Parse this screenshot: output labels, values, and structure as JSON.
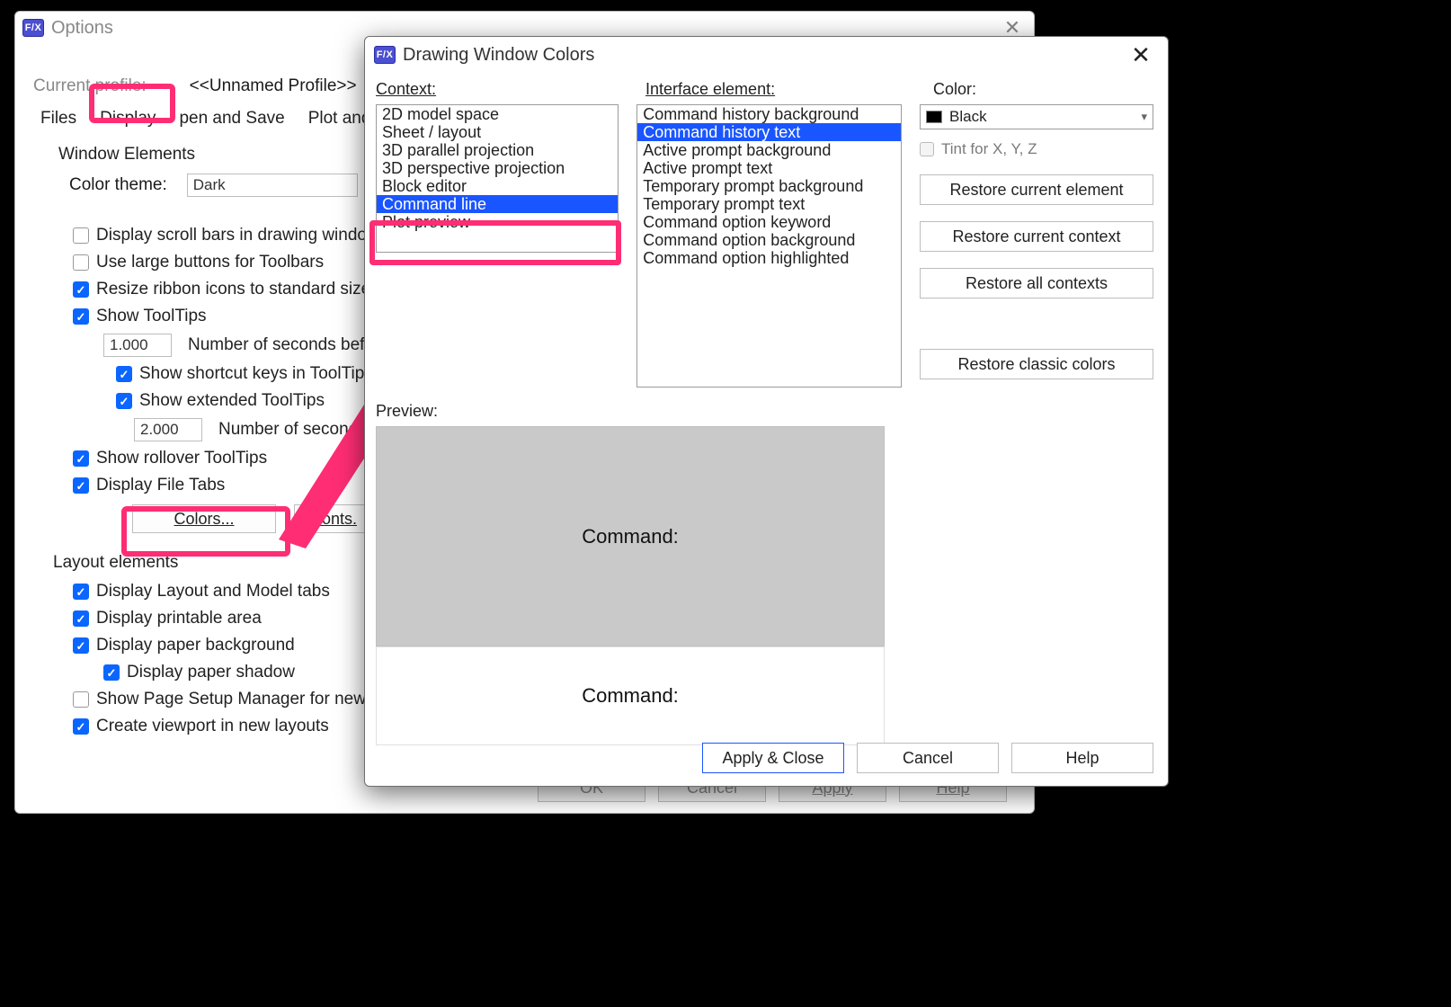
{
  "options": {
    "title": "Options",
    "currentProfileLbl": "Current profile:",
    "currentProfile": "<<Unnamed Profile>>",
    "tabs": [
      "Files",
      "Display",
      "pen and Save",
      "Plot and Pub"
    ],
    "winElemsHead": "Window Elements",
    "colorThemeLbl": "Color theme:",
    "colorTheme": "Dark",
    "ck_scroll": "Display scroll bars in drawing window",
    "ck_large": "Use large buttons for Toolbars",
    "ck_resize": "Resize ribbon icons to standard sizes",
    "ck_tooltips": "Show ToolTips",
    "tt_delay1": "1.000",
    "tt_delay1_lbl": "Number of seconds before",
    "ck_shortcut": "Show shortcut keys in ToolTips",
    "ck_ext": "Show extended ToolTips",
    "tt_delay2": "2.000",
    "tt_delay2_lbl": "Number of seconds to de",
    "ck_rollover": "Show rollover ToolTips",
    "ck_filetabs": "Display File Tabs",
    "btn_colors": "Colors...",
    "btn_fonts": "Fonts.",
    "layHead": "Layout elements",
    "ck_lm": "Display Layout and Model tabs",
    "ck_pa": "Display printable area",
    "ck_pb": "Display paper background",
    "ck_ps": "Display paper shadow",
    "ck_smgr": "Show Page Setup Manager for new lay",
    "ck_vp": "Create viewport in new layouts",
    "foot_ok": "OK",
    "foot_cancel": "Cancel",
    "foot_apply": "Apply",
    "foot_help": "Help"
  },
  "dwc": {
    "title": "Drawing Window Colors",
    "hdr_context": "Context:",
    "hdr_elem": "Interface element:",
    "hdr_color": "Color:",
    "ctx": [
      "2D model space",
      "Sheet / layout",
      "3D parallel projection",
      "3D perspective projection",
      "Block editor",
      "Command line",
      "Plot preview"
    ],
    "ctx_selected": "Command line",
    "elem": [
      "Command history background",
      "Command history text",
      "Active prompt background",
      "Active prompt text",
      "Temporary prompt background",
      "Temporary prompt text",
      "Command option keyword",
      "Command option background",
      "Command option highlighted"
    ],
    "elem_selected": "Command history text",
    "color_name": "Black",
    "tint": "Tint for X, Y, Z",
    "b_rce": "Restore current element",
    "b_rcc": "Restore current context",
    "b_rac": "Restore all contexts",
    "b_rcls": "Restore classic colors",
    "preview_lbl": "Preview:",
    "preview_cmd": "Command:",
    "foot_apply": "Apply & Close",
    "foot_cancel": "Cancel",
    "foot_help": "Help"
  }
}
